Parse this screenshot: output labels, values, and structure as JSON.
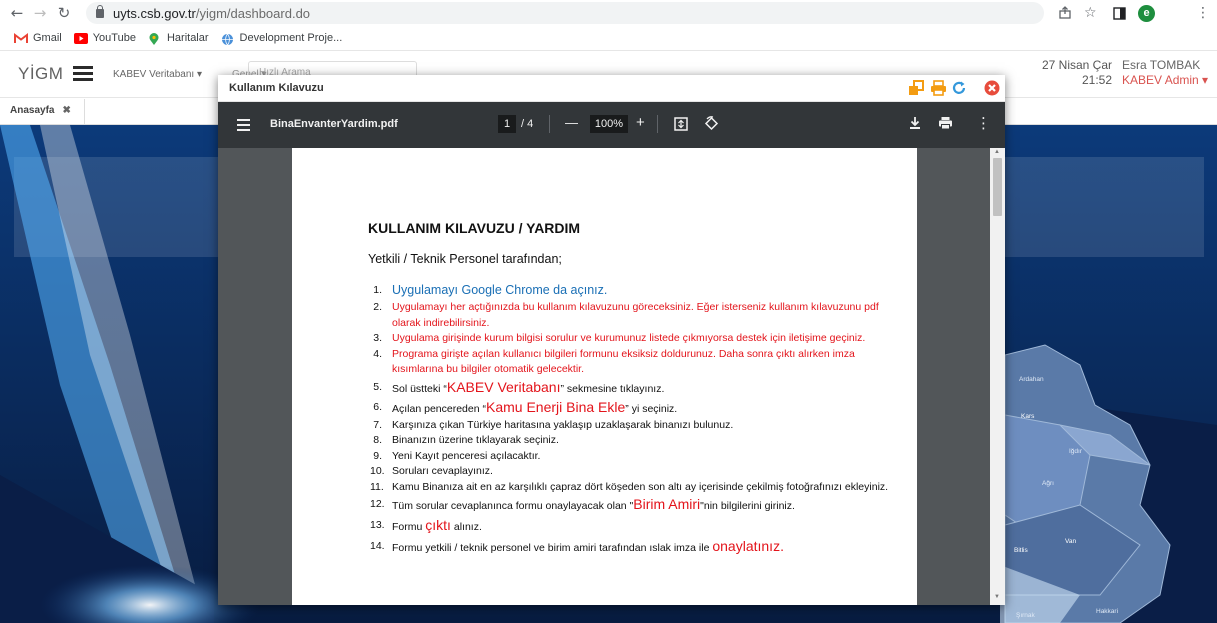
{
  "browser": {
    "url_host": "uyts.csb.gov.tr",
    "url_path": "/yigm/dashboard.do",
    "profile_initial": "e",
    "bookmarks": [
      {
        "label": "Gmail",
        "color": "#ea4335"
      },
      {
        "label": "YouTube",
        "color": "#ff0000"
      },
      {
        "label": "Haritalar",
        "color": "#34a853"
      },
      {
        "label": "Development Proje...",
        "color": "#4a90d9"
      }
    ]
  },
  "app": {
    "logo": "YİGM",
    "menu_kabev": "KABEV Veritabanı ▾",
    "menu_genel": "Genel ▾",
    "search_placeholder": "Hızlı Arama",
    "date": "27 Nisan Çar",
    "time": "21:52",
    "user_name": "Esra TOMBAK",
    "user_role": "KABEV Admin ▾",
    "home_tab": "Anasayfa",
    "home_tab_close": "✖"
  },
  "map": {
    "labels": [
      "Ardahan",
      "Kars",
      "Iğdır",
      "Ağrı",
      "Van",
      "Bitlis",
      "Hakkari",
      "Şırnak"
    ]
  },
  "modal": {
    "title": "Kullanım Kılavuzu",
    "colors": {
      "orange": "#f39c12",
      "blue": "#3498db",
      "red": "#e74c3c"
    },
    "pdf": {
      "filename": "BinaEnvanterYardim.pdf",
      "page_current": "1",
      "page_total": "/ 4",
      "zoom": "100%",
      "minus": "—",
      "plus": "+"
    }
  },
  "document": {
    "title": "KULLANIM KILAVUZU / YARDIM",
    "subtitle": "Yetkili / Teknik Personel tarafından;",
    "items": {
      "n1": "1.",
      "t1": "Uygulamayı Google Chrome da açınız.",
      "n2": "2.",
      "t2": "Uygulamayı her açtığınızda bu kullanım kılavuzunu göreceksiniz. Eğer isterseniz kullanım kılavuzunu pdf olarak indirebilirsiniz.",
      "n3": "3.",
      "t3": "Uygulama girişinde kurum bilgisi sorulur ve kurumunuz listede çıkmıyorsa destek için iletişime geçiniz.",
      "n4": "4.",
      "t4": "Programa girişte açılan kullanıcı bilgileri formunu eksiksiz doldurunuz. Daha sonra çıktı alırken imza kısımlarına bu bilgiler otomatik gelecektir.",
      "n5": "5.",
      "t5a": "Sol üstteki “",
      "t5b": "KABEV Veritabanı",
      "t5c": "” sekmesine tıklayınız.",
      "n6": "6.",
      "t6a": "Açılan pencereden “",
      "t6b": "Kamu Enerji Bina Ekle",
      "t6c": "” yi seçiniz.",
      "n7": "7.",
      "t7": "Karşınıza çıkan Türkiye haritasına yaklaşıp uzaklaşarak binanızı bulunuz.",
      "n8": "8.",
      "t8": "Binanızın üzerine tıklayarak seçiniz.",
      "n9": "9.",
      "t9": "Yeni Kayıt penceresi açılacaktır.",
      "n10": "10.",
      "t10": "Soruları cevaplayınız.",
      "n11": "11.",
      "t11": "Kamu Binanıza ait en az karşılıklı çapraz dört köşeden son altı ay içerisinde çekilmiş fotoğrafınızı ekleyiniz.",
      "n12": "12.",
      "t12a": "Tüm sorular cevaplanınca formu onaylayacak olan \"",
      "t12b": "Birim Amiri",
      "t12c": "\"nin bilgilerini giriniz.",
      "n13": "13.",
      "t13a": "Formu ",
      "t13b": "çıktı",
      "t13c": " alınız.",
      "n14": "14.",
      "t14a": "Formu yetkili / teknik personel ve birim amiri tarafından ıslak imza ile ",
      "t14b": "onaylatınız."
    }
  }
}
